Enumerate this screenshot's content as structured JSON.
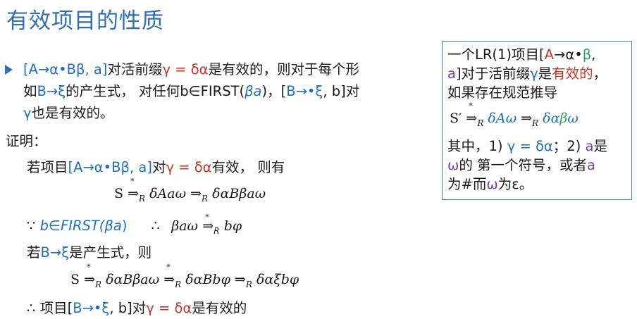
{
  "title": "有效项目的性质",
  "main": {
    "line1": {
      "item": "[A→α•Bβ, a]",
      "t1": "对活前缀",
      "gamma": "γ = δα",
      "t2": "是有效的，则对于每个形"
    },
    "line2": {
      "t1": "如",
      "prod": "B→ξ",
      "t2": "的产生式，  对任何b∈FIRST(",
      "ba": "βa",
      "t3": ")，[",
      "item": "B→•ξ",
      "t4": ", b]对"
    },
    "line3": {
      "gamma": "γ",
      "t1": "也是有效的。"
    },
    "proof_label": "证明：",
    "p1": {
      "t1": "若项目",
      "item": "[A→α•Bβ, a]",
      "t2": "对",
      "gamma": "γ = δα",
      "t3": "有效，  则有"
    },
    "d1": {
      "s": "S",
      "arrow1": "⇒",
      "r1": "R",
      "f1": "δAaω",
      "arrow2": "⇒",
      "r2": "R",
      "f2": "δαBβaω"
    },
    "p2": {
      "because": "∵",
      "b": "b∈FIRST(",
      "ba": "βa",
      "close": ")",
      "therefore": "∴",
      "f1": "βaω",
      "arrow": "⇒",
      "r": "R",
      "f2": "bφ"
    },
    "p3": {
      "t1": "若",
      "prod": "B→ξ",
      "t2": "是产生式，则"
    },
    "d2": {
      "s": "S",
      "arrow1": "⇒",
      "r1": "R",
      "f1": "δαBβaω",
      "arrow2": "⇒",
      "r2": "R",
      "f2": "δαBbφ",
      "arrow3": "⇒",
      "r3": "R",
      "f3": "δαξbφ"
    },
    "p4": {
      "therefore": "∴ 项目[",
      "item": "B→•ξ",
      "t1": ", b]对",
      "gamma": "γ = δα",
      "t2": "是有效的"
    },
    "star": "*"
  },
  "box": {
    "l1": {
      "t1": "一个LR(1)项目[",
      "a": "A",
      "arrow": "→α•",
      "beta": "β",
      "comma": ","
    },
    "l2": {
      "a": "a",
      "t1": "]对于活前缀",
      "gamma": "γ",
      "t2": "是",
      "valid": "有效的",
      "comma": "，"
    },
    "l3": "如果存在规范推导",
    "l4": {
      "s": "S′",
      "arrow1": "⇒",
      "r1": "R",
      "f1": "δAω",
      "arrow2": "⇒",
      "r2": "R",
      "f2a": "δα",
      "f2b": "β",
      "f2c": "ω"
    },
    "l5": {
      "t1": "其中，1) ",
      "gamma": "γ = δα",
      "t2": "；2) ",
      "a": "a",
      "t3": "是"
    },
    "l6": {
      "omega": "ω",
      "t1": "的 第一个符号，或者",
      "a": "a"
    },
    "l7": {
      "t1": "为#而",
      "omega": "ω",
      "t2": "为ε。"
    }
  }
}
